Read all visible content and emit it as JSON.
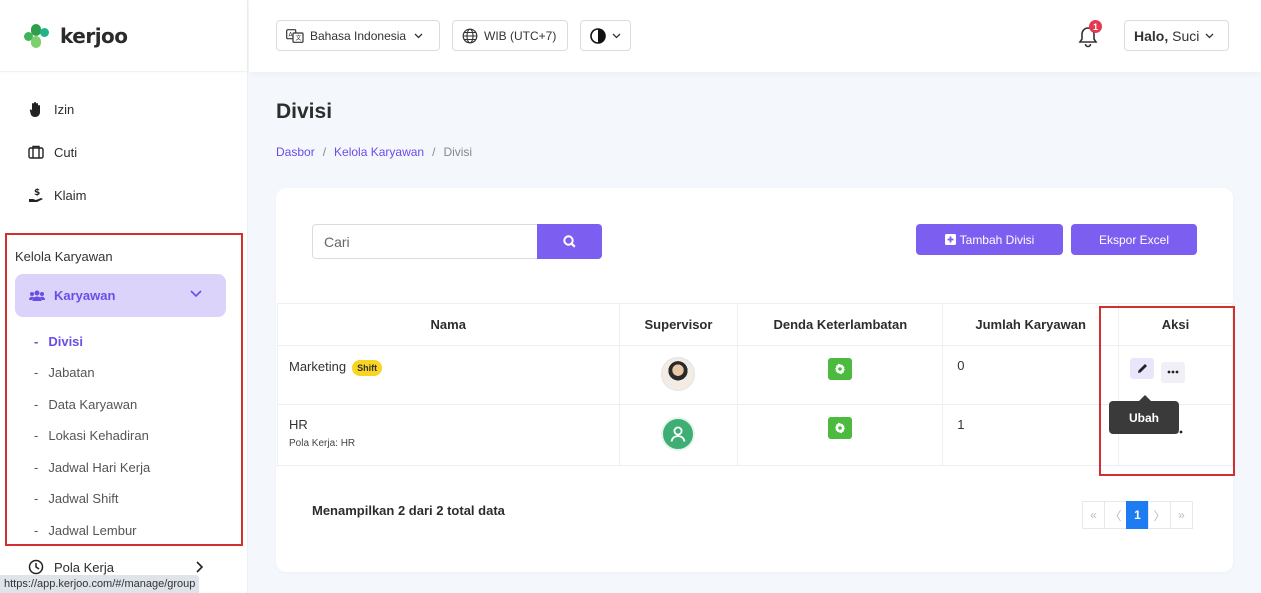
{
  "brand": {
    "name": "kerjoo"
  },
  "sidebar": {
    "top_items": [
      {
        "label": "Izin",
        "icon": "hand-icon"
      },
      {
        "label": "Cuti",
        "icon": "briefcase-icon"
      },
      {
        "label": "Klaim",
        "icon": "money-hand-icon"
      }
    ],
    "section_title": "Kelola Karyawan",
    "group": {
      "label": "Karyawan",
      "icon": "users-icon"
    },
    "sub_items": [
      "Divisi",
      "Jabatan",
      "Data Karyawan",
      "Lokasi Kehadiran",
      "Jadwal Hari Kerja",
      "Jadwal Shift",
      "Jadwal Lembur"
    ],
    "active_sub": "Divisi",
    "bottom_item": {
      "label": "Pola Kerja",
      "icon": "clock-icon"
    }
  },
  "status_url": "https://app.kerjoo.com/#/manage/group",
  "topbar": {
    "language": "Bahasa Indonesia",
    "timezone": "WIB (UTC+7)",
    "notification_count": "1",
    "greeting_bold": "Halo,",
    "greeting_name": "Suci"
  },
  "page": {
    "title": "Divisi",
    "breadcrumb": [
      "Dasbor",
      "Kelola Karyawan",
      "Divisi"
    ]
  },
  "toolbar": {
    "search_placeholder": "Cari",
    "add_button": "Tambah Divisi",
    "export_button": "Ekspor Excel"
  },
  "table": {
    "columns": [
      "Nama",
      "Supervisor",
      "Denda Keterlambatan",
      "Jumlah Karyawan",
      "Aksi"
    ],
    "rows": [
      {
        "name": "Marketing",
        "badge": "Shift",
        "note": "",
        "count": "0"
      },
      {
        "name": "HR",
        "badge": "",
        "note": "Pola Kerja: HR",
        "count": "1"
      }
    ]
  },
  "tooltip": "Ubah",
  "summary": "Menampilkan 2 dari 2 total data",
  "pagination": {
    "first": "«",
    "prev": "〈",
    "current": "1",
    "next": "〉",
    "last": "»"
  },
  "colors": {
    "accent": "#7c5ff0",
    "success": "#4cba3e",
    "highlight_box": "#d32f2f"
  }
}
